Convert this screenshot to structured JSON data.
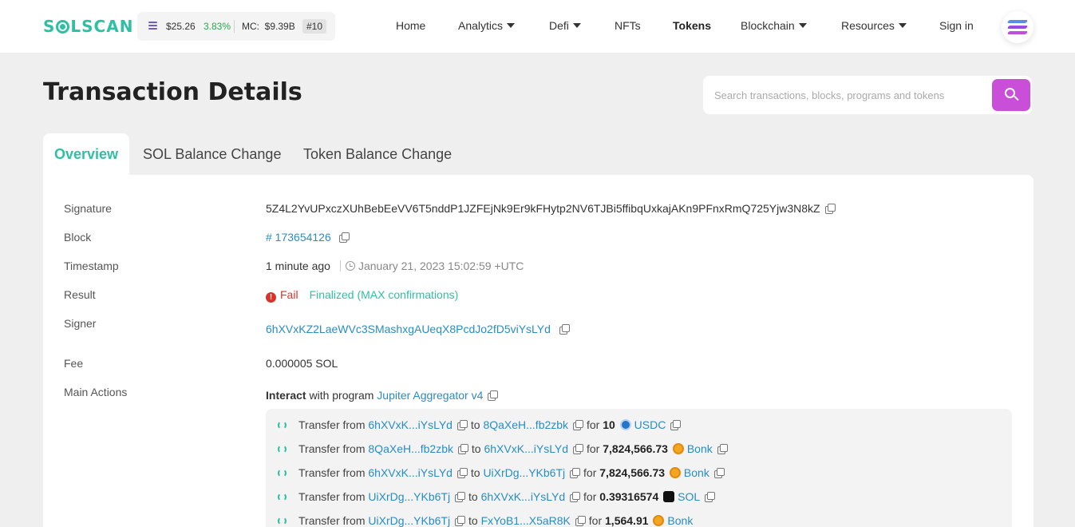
{
  "header": {
    "logo_prefix": "S",
    "logo_suffix": "LSCAN",
    "price": "$25.26",
    "change": "3.83%",
    "mc_label": "MC:",
    "mc_value": "$9.39B",
    "rank": "#10",
    "nav": [
      "Home",
      "Analytics",
      "Defi",
      "NFTs",
      "Tokens",
      "Blockchain",
      "Resources",
      "Sign in"
    ]
  },
  "page": {
    "title": "Transaction Details",
    "search_placeholder": "Search transactions, blocks, programs and tokens"
  },
  "tabs": [
    "Overview",
    "SOL Balance Change",
    "Token Balance Change"
  ],
  "details": {
    "labels": {
      "signature": "Signature",
      "block": "Block",
      "timestamp": "Timestamp",
      "result": "Result",
      "signer": "Signer",
      "fee": "Fee",
      "main_actions": "Main Actions"
    },
    "signature": "5Z4L2YvUPxczXUhBebEeVV6T5nddP1JZFEjNk9Er9kFHytp2NV6TJBi5ffibqUxkajAKn9PFnxRmQ725Yjw3N8kZ",
    "block": "# 173654126",
    "time_ago": "1 minute ago",
    "timestamp": "January 21, 2023 15:02:59 +UTC",
    "result_status": "Fail",
    "result_finality": "Finalized (MAX confirmations)",
    "signer": "6hXVxKZ2LaeWVc3SMashxgAUeqX8PcdJo2fD5viYsLYd",
    "fee": "0.000005 SOL",
    "interact_label": "Interact",
    "interact_text": "with program",
    "program": "Jupiter Aggregator v4"
  },
  "actions": [
    {
      "prefix": "Transfer from",
      "from": "6hXVxK...iYsLYd",
      "to_label": "to",
      "to": "8QaXeH...fb2zbk",
      "for_label": "for",
      "amount": "10",
      "token": "USDC",
      "token_icon": "usdc"
    },
    {
      "prefix": "Transfer from",
      "from": "8QaXeH...fb2zbk",
      "to_label": "to",
      "to": "6hXVxK...iYsLYd",
      "for_label": "for",
      "amount": "7,824,566.73",
      "token": "Bonk",
      "token_icon": "bonk"
    },
    {
      "prefix": "Transfer from",
      "from": "6hXVxK...iYsLYd",
      "to_label": "to",
      "to": "UiXrDg...YKb6Tj",
      "for_label": "for",
      "amount": "7,824,566.73",
      "token": "Bonk",
      "token_icon": "bonk"
    },
    {
      "prefix": "Transfer from",
      "from": "UiXrDg...YKb6Tj",
      "to_label": "to",
      "to": "6hXVxK...iYsLYd",
      "for_label": "for",
      "amount": "0.39316574",
      "token": "SOL",
      "token_icon": "sol"
    },
    {
      "prefix": "Transfer from",
      "from": "UiXrDg...YKb6Tj",
      "to_label": "to",
      "to": "FxYoB1...X5aR8K",
      "for_label": "for",
      "amount": "1,564.91",
      "token": "Bonk",
      "token_icon": "bonk"
    }
  ],
  "colors": {
    "accent": "#2fbfa3",
    "link": "#2a8cc1",
    "search_button": "#c94ed8",
    "fail": "#d9342b",
    "positive_change": "#2ea44f"
  }
}
